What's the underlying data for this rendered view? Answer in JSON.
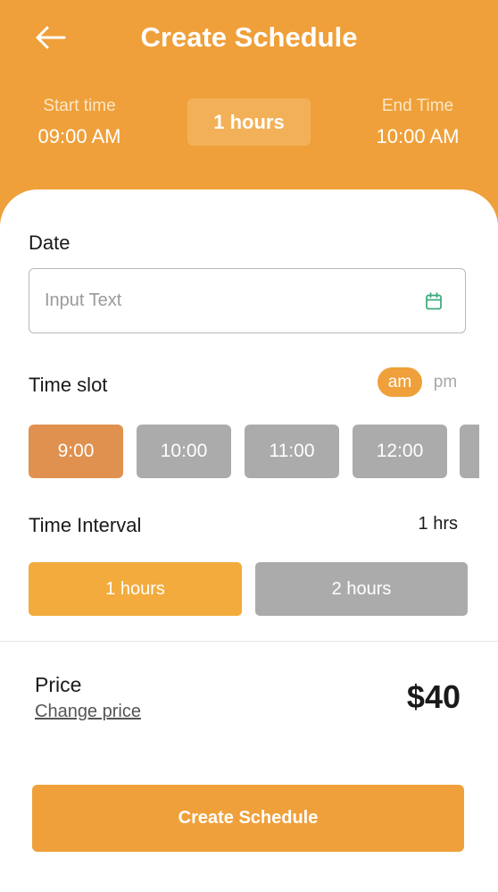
{
  "header": {
    "title": "Create Schedule",
    "start_label": "Start time",
    "start_value": "09:00 AM",
    "duration_badge": "1 hours",
    "end_label": "End Time",
    "end_value": "10:00 AM",
    "back_icon": "arrow-left-icon"
  },
  "date": {
    "label": "Date",
    "placeholder": "Input Text",
    "value": "",
    "icon": "calendar-icon"
  },
  "time_slot": {
    "label": "Time slot",
    "am_label": "am",
    "pm_label": "pm",
    "selected_period": "am",
    "slots": [
      "9:00",
      "10:00",
      "11:00",
      "12:00"
    ],
    "selected": "9:00"
  },
  "interval": {
    "label": "Time Interval",
    "value": "1 hrs",
    "options": [
      "1 hours",
      "2 hours"
    ],
    "selected": "1 hours"
  },
  "price": {
    "label": "Price",
    "change_label": "Change price",
    "value": "$40"
  },
  "create_button": "Create Schedule",
  "colors": {
    "primary": "#EFA03A",
    "slot_active": "#E0914F",
    "inactive": "#ABABAB"
  }
}
